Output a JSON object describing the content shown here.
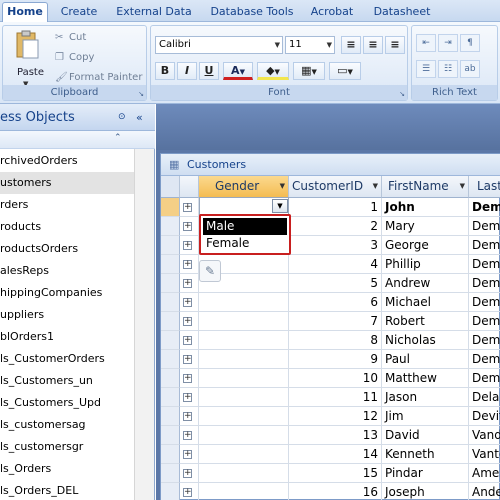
{
  "ribbon": {
    "tabs": [
      "Home",
      "Create",
      "External Data",
      "Database Tools",
      "Acrobat",
      "Datasheet"
    ],
    "clipboard": {
      "paste": "Paste",
      "cut": "Cut",
      "copy": "Copy",
      "format_painter": "Format Painter",
      "label": "Clipboard"
    },
    "font": {
      "family": "Calibri",
      "size": "11",
      "label": "Font"
    },
    "rich_text": {
      "label": "Rich Text"
    }
  },
  "nav": {
    "title": "ess Objects",
    "items": [
      "rchivedOrders",
      "ustomers",
      "rders",
      "roducts",
      "roductsOrders",
      "alesReps",
      "hippingCompanies",
      "uppliers",
      "blOrders1",
      "ls_CustomerOrders",
      "ls_Customers_un",
      "ls_Customers_Upd",
      "ls_customersag",
      "ls_customersgr",
      "ls_Orders",
      "ls_Orders_DEL"
    ],
    "selected_index": 1
  },
  "window": {
    "title": "Customers",
    "columns": {
      "gender": "Gender",
      "customer_id": "CustomerID",
      "first_name": "FirstName",
      "last": "Last"
    },
    "rows": [
      {
        "id": "1",
        "first": "John",
        "last": "Dema"
      },
      {
        "id": "2",
        "first": "Mary",
        "last": "Dema"
      },
      {
        "id": "3",
        "first": "George",
        "last": "Deme"
      },
      {
        "id": "4",
        "first": "Phillip",
        "last": "Deme"
      },
      {
        "id": "5",
        "first": "Andrew",
        "last": "Demi"
      },
      {
        "id": "6",
        "first": "Michael",
        "last": "Demi"
      },
      {
        "id": "7",
        "first": "Robert",
        "last": "Dema"
      },
      {
        "id": "8",
        "first": "Nicholas",
        "last": "Dema"
      },
      {
        "id": "9",
        "first": "Paul",
        "last": "Dema"
      },
      {
        "id": "10",
        "first": "Matthew",
        "last": "Dema"
      },
      {
        "id": "11",
        "first": "Jason",
        "last": "Delan"
      },
      {
        "id": "12",
        "first": "Jim",
        "last": "Devit"
      },
      {
        "id": "13",
        "first": "David",
        "last": "Vand"
      },
      {
        "id": "14",
        "first": "Kenneth",
        "last": "Vanto"
      },
      {
        "id": "15",
        "first": "Pindar",
        "last": "Ames"
      },
      {
        "id": "16",
        "first": "Joseph",
        "last": "Ande"
      }
    ],
    "dropdown_options": [
      "Male",
      "Female"
    ]
  }
}
